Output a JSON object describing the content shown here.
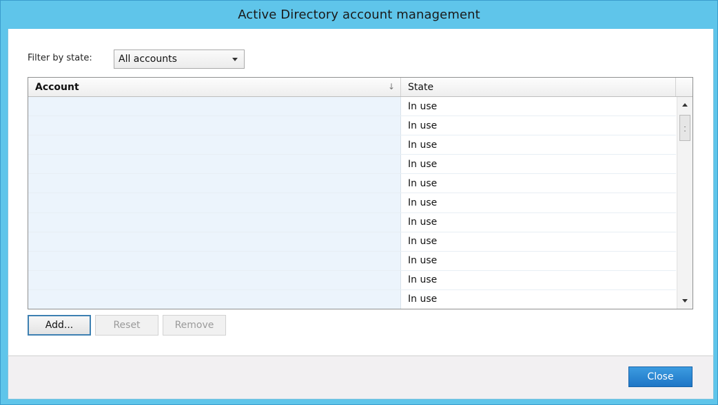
{
  "window": {
    "title": "Active Directory account management"
  },
  "filter": {
    "label": "Filter by state:",
    "selected": "All accounts"
  },
  "grid": {
    "columns": {
      "account": "Account",
      "state": "State"
    },
    "rows": [
      {
        "account": "",
        "state": "In use"
      },
      {
        "account": "",
        "state": "In use"
      },
      {
        "account": "",
        "state": "In use"
      },
      {
        "account": "",
        "state": "In use"
      },
      {
        "account": "",
        "state": "In use"
      },
      {
        "account": "",
        "state": "In use"
      },
      {
        "account": "",
        "state": "In use"
      },
      {
        "account": "",
        "state": "In use"
      },
      {
        "account": "",
        "state": "In use"
      },
      {
        "account": "",
        "state": "In use"
      },
      {
        "account": "",
        "state": "In use"
      }
    ]
  },
  "buttons": {
    "add": "Add...",
    "reset": "Reset",
    "remove": "Remove",
    "close": "Close"
  },
  "icons": {
    "sort": "sort-descending-icon",
    "dropdown": "chevron-down-icon",
    "scroll_up": "scroll-up-icon",
    "scroll_down": "scroll-down-icon"
  },
  "colors": {
    "titlebar": "#5fc5ea",
    "primary_button": "#2b88d4",
    "account_column_bg": "#ecf4fc"
  }
}
